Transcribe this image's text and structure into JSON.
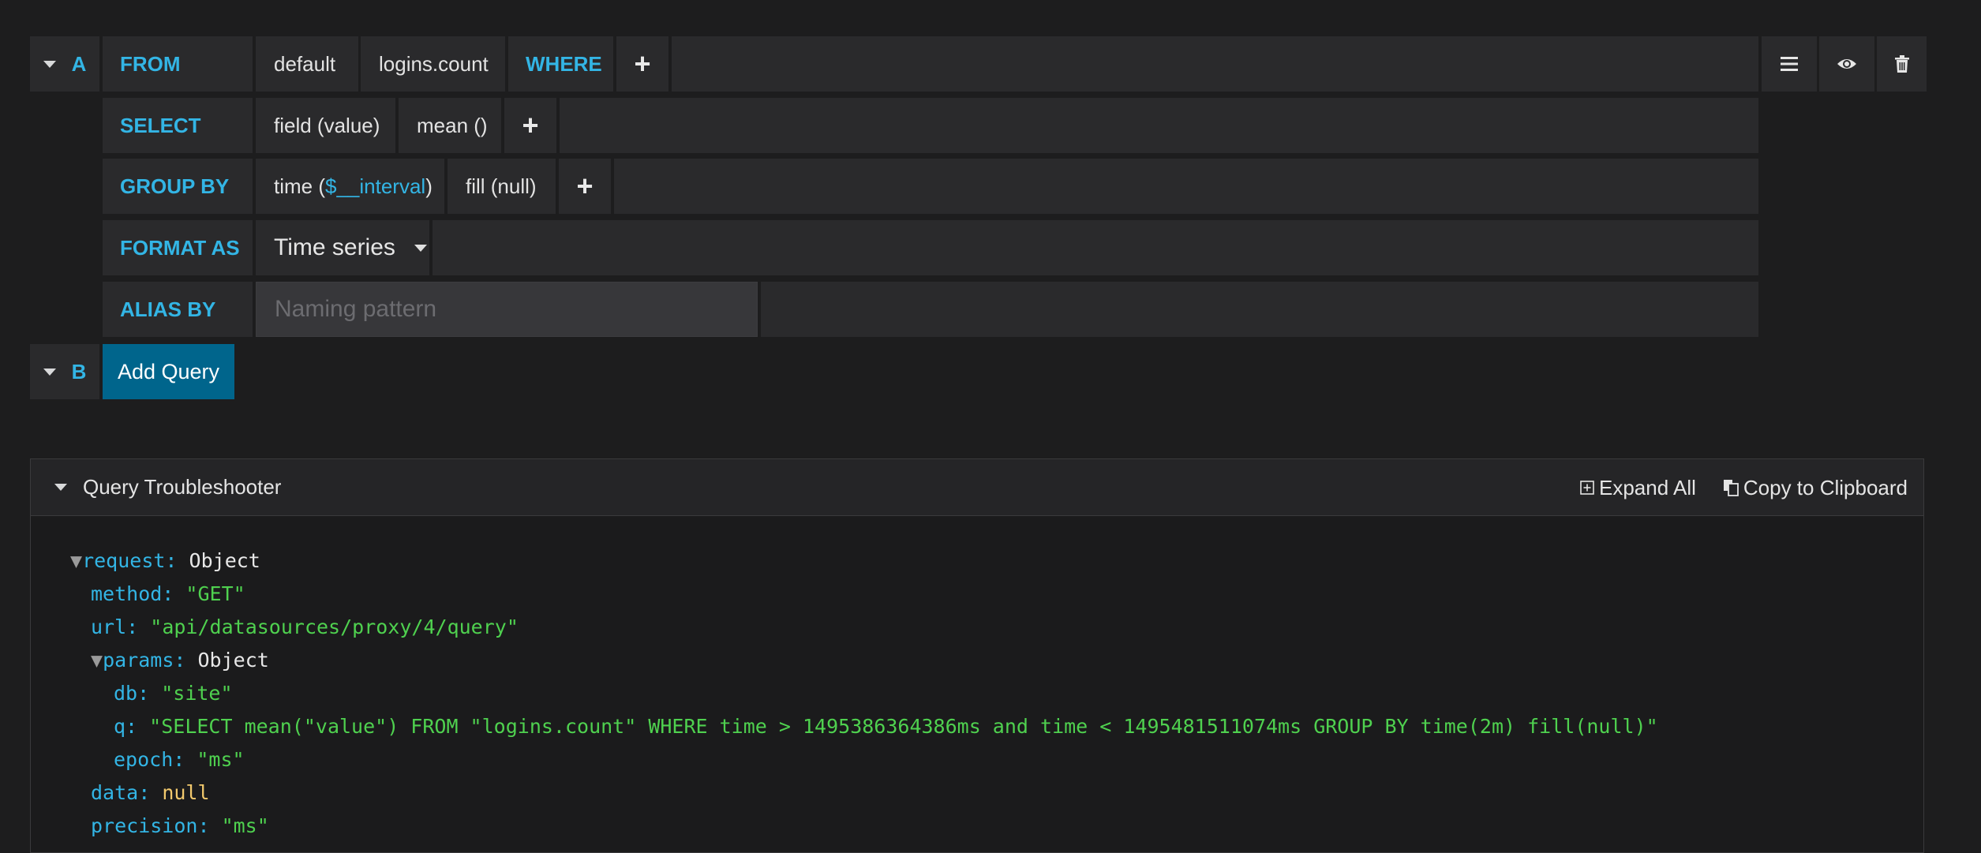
{
  "query_a": {
    "ref_id": "A",
    "from_label": "FROM",
    "policy": "default",
    "measurement": "logins.count",
    "where_label": "WHERE",
    "select_label": "SELECT",
    "select_field": "field (value)",
    "select_agg": "mean ()",
    "group_by_label": "GROUP BY",
    "group_time_prefix": "time (",
    "group_time_var": "$__interval",
    "group_time_suffix": ")",
    "group_fill": "fill (null)",
    "format_as_label": "FORMAT AS",
    "format_value": "Time series",
    "alias_by_label": "ALIAS BY",
    "alias_placeholder": "Naming pattern",
    "plus": "+"
  },
  "query_b": {
    "ref_id": "B",
    "add_query_label": "Add Query"
  },
  "icons": {
    "menu": "hamburger-icon",
    "toggle": "eye-icon",
    "delete": "trash-icon"
  },
  "troubleshooter": {
    "title": "Query Troubleshooter",
    "expand_all": "Expand All",
    "copy": "Copy to Clipboard",
    "request_key": "request:",
    "request_val": "Object",
    "method_key": "method:",
    "method_val": "\"GET\"",
    "url_key": "url:",
    "url_val": "\"api/datasources/proxy/4/query\"",
    "params_key": "params:",
    "params_val": "Object",
    "db_key": "db:",
    "db_val": "\"site\"",
    "q_key": "q:",
    "q_val": "\"SELECT mean(\"value\") FROM \"logins.count\" WHERE time > 1495386364386ms and time < 1495481511074ms GROUP BY time(2m) fill(null)\"",
    "epoch_key": "epoch:",
    "epoch_val": "\"ms\"",
    "data_key": "data:",
    "data_val": "null",
    "precision_key": "precision:",
    "precision_val": "\"ms\""
  },
  "colors": {
    "keyword": "#33b5e5",
    "string": "#4fd14f",
    "null": "#f2c96d",
    "primary_button": "#00658c"
  }
}
